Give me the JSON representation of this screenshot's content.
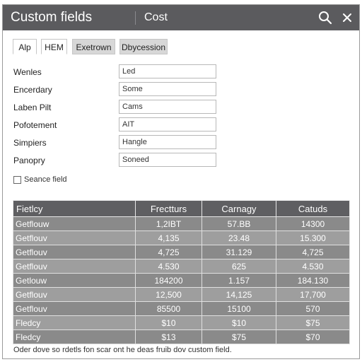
{
  "window": {
    "title": "Custom fields",
    "subtitle": "Cost"
  },
  "icons": {
    "search": "search-icon",
    "close": "close-icon"
  },
  "tabs": [
    {
      "label": "Alp",
      "active": true
    },
    {
      "label": "HEM",
      "active": true
    },
    {
      "label": "Exetrown",
      "active": false
    },
    {
      "label": "Dbycession",
      "active": false
    }
  ],
  "form": {
    "fields": [
      {
        "label": "Wenles",
        "value": "Led"
      },
      {
        "label": "Encerdary",
        "value": "Some"
      },
      {
        "label": "Laben Pilt",
        "value": "Cams"
      },
      {
        "label": "Pofotement",
        "value": "AIT"
      },
      {
        "label": "Simpiers",
        "value": "Hangle"
      },
      {
        "label": "Panopry",
        "value": "Soneed"
      }
    ],
    "checkbox_label": "Seance field",
    "checkbox_checked": false
  },
  "table": {
    "headers": [
      "Fietlcy",
      "Frectturs",
      "Carnagy",
      "Catuds"
    ],
    "rows": [
      [
        "Getflouw",
        "1,2IBT",
        "57.BB",
        "14300"
      ],
      [
        "Getflouv",
        "4,135",
        "23.48",
        "15.300"
      ],
      [
        "Getflouv",
        "4,725",
        "31.129",
        "4,725"
      ],
      [
        "Getflouv",
        "4.530",
        "625",
        "4.530"
      ],
      [
        "Getlouw",
        "184200",
        "1.157",
        "184.130"
      ],
      [
        "Getflouv",
        "12,500",
        "14,125",
        "17,700"
      ],
      [
        "Getflouv",
        "85500",
        "15100",
        "570"
      ],
      [
        "Fledcy",
        "$10",
        "$10",
        "$75"
      ],
      [
        "Fledcy",
        "$13",
        "$75",
        "$70"
      ]
    ]
  },
  "footer": {
    "text": "Oder dove so rdetls fon scar ont he deas fruib dov custom field."
  },
  "colors": {
    "titlebar": "#5b5b5e",
    "table_header": "#5f5f62",
    "row_dark": "#8a8a8a",
    "row_light": "#9e9e9e"
  }
}
